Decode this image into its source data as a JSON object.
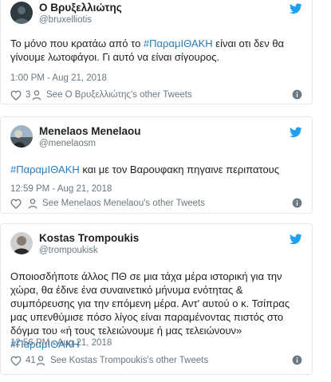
{
  "tweets": [
    {
      "display_name": "Ο Βρυξελλιώτης",
      "handle": "@bruxelliotis",
      "text_before": "Το μόνο που κρατάω από το ",
      "hashtag": "#ΠαραμΙΘΑΚΗ",
      "text_after": " είναι οτι δεν θα γίνουμε λωτοφάγοι. Γι αυτό να είναι σίγουρος.",
      "date": "1:00 PM - Aug 21, 2018",
      "likes": "3",
      "others_label": "See Ο Βρυξελλιώτης's other Tweets",
      "avatar_icon": "avatar-silhouette-dark"
    },
    {
      "display_name": "Menelaos Menelaou",
      "handle": "@menelaosm",
      "hashtag": "#ΠαραμΙΘΑΚΗ",
      "text_after": " και με τον Βαρουφακη πηγαινε περιπατους",
      "date": "12:59 PM - Aug 21, 2018",
      "likes": "",
      "others_label": "See Menelaos Menelaou's other Tweets",
      "avatar_icon": "avatar-photo-landscape"
    },
    {
      "display_name": "Kostas Trompoukis",
      "handle": "@trompoukisk",
      "text_before": "Οποιοσδήποτε άλλος ΠΘ σε μια τάχα μέρα ιστορική για την χώρα, θα έδινε ένα συναινετικό μήνυμα ενότητας & συμπόρευσης για την επόμενη μέρα. Αντ' αυτού ο κ. Τσίπρας μας υπενθύμισε πόσο λίγος είναι παραμένοντας πιστός στο δόγμα του «ή τους τελειώνουμε ή μας τελειώνουν» ",
      "hashtag": "#ΠαραμΙΘΑΚΗ",
      "date": "12:56 PM - Aug 21, 2018",
      "likes": "41",
      "others_label": "See Kostas Trompoukis's other Tweets",
      "avatar_icon": "avatar-photo-portrait"
    }
  ],
  "icons": {
    "brand": "twitter-bird-icon",
    "like": "heart-icon",
    "others": "person-icon",
    "info": "info-icon"
  },
  "colors": {
    "twitter_blue": "#1da1f2",
    "hashtag": "#2b7bb9",
    "muted_text": "#697882",
    "border": "#e1e8ed"
  }
}
